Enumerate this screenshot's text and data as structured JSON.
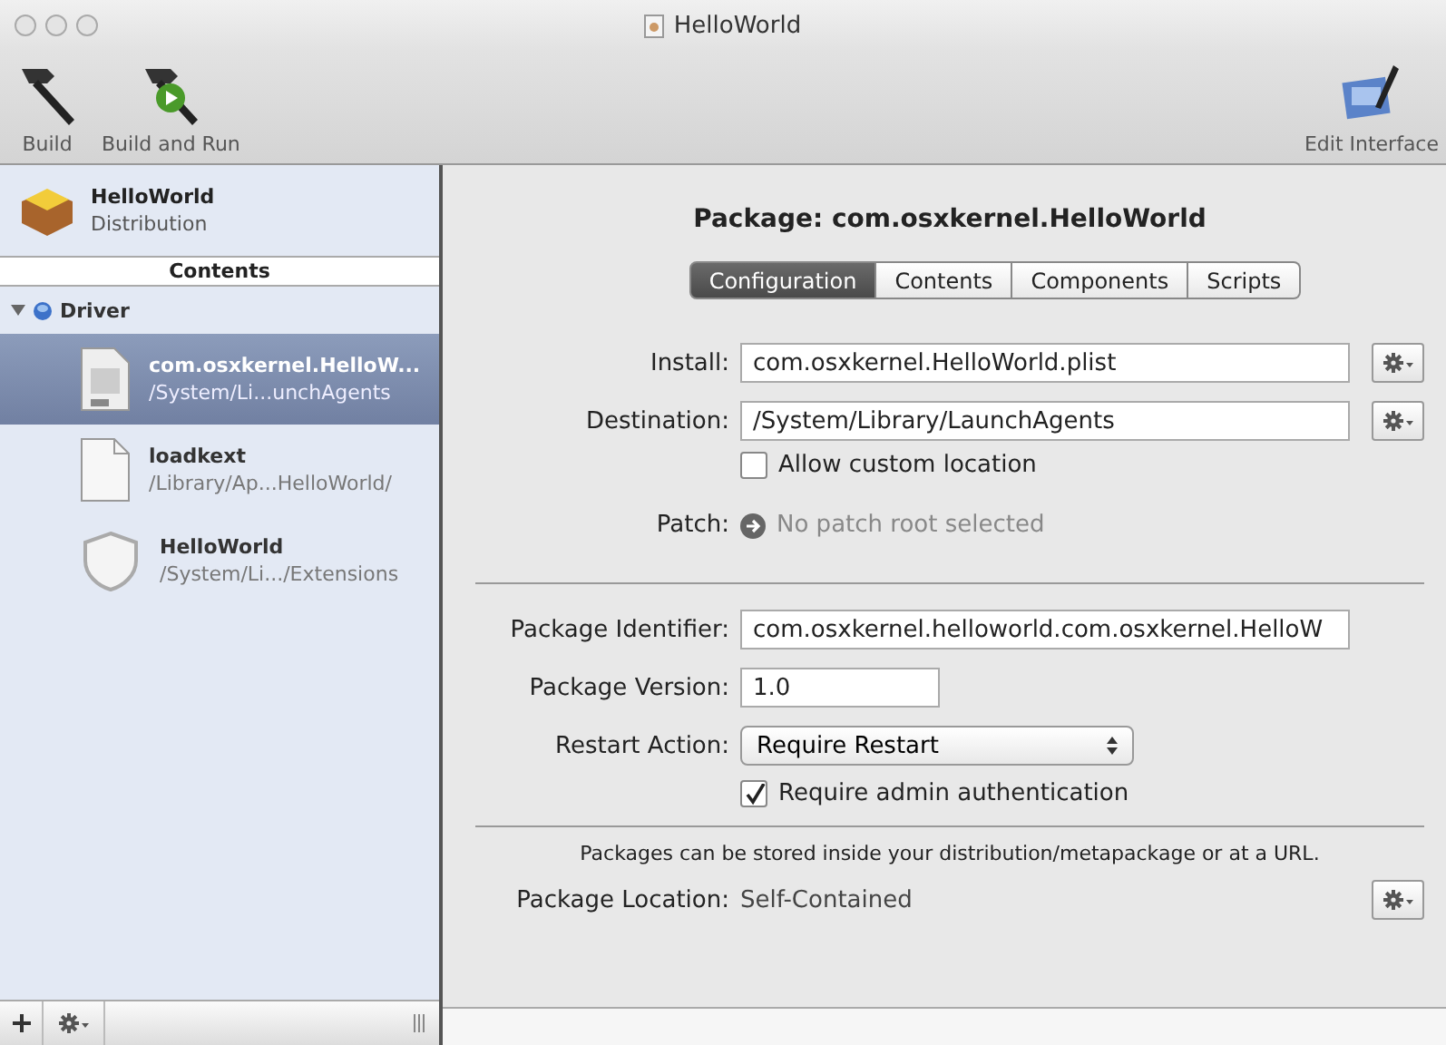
{
  "window": {
    "title": "HelloWorld"
  },
  "toolbar": {
    "items": [
      {
        "label": "Build",
        "kind": "build"
      },
      {
        "label": "Build and Run",
        "kind": "build_run"
      },
      {
        "label": "Edit Interface",
        "kind": "edit_interface"
      }
    ]
  },
  "sidebar": {
    "header": {
      "title": "HelloWorld",
      "subtitle": "Distribution"
    },
    "section_label": "Contents",
    "tree": [
      {
        "label": "Driver",
        "expanded": true,
        "children": [
          {
            "name": "com.osxkernel.HelloW...",
            "path": "/System/Li...unchAgents",
            "kind": "plist",
            "selected": true
          },
          {
            "name": "loadkext",
            "path": "/Library/Ap...HelloWorld/",
            "kind": "file",
            "selected": false
          },
          {
            "name": "HelloWorld",
            "path": "/System/Li.../Extensions",
            "kind": "kext",
            "selected": false
          }
        ]
      }
    ]
  },
  "main": {
    "title": "Package: com.osxkernel.HelloWorld",
    "tabs": [
      {
        "label": "Configuration",
        "selected": true
      },
      {
        "label": "Contents",
        "selected": false
      },
      {
        "label": "Components",
        "selected": false
      },
      {
        "label": "Scripts",
        "selected": false
      }
    ],
    "install": {
      "label": "Install:",
      "value": "com.osxkernel.HelloWorld.plist"
    },
    "destination": {
      "label": "Destination:",
      "value": "/System/Library/LaunchAgents"
    },
    "allow_custom": {
      "label": "Allow custom location",
      "checked": false
    },
    "patch": {
      "label": "Patch:",
      "value": "No patch root selected"
    },
    "identifier": {
      "label": "Package Identifier:",
      "value": "com.osxkernel.helloworld.com.osxkernel.HelloW"
    },
    "version": {
      "label": "Package Version:",
      "value": "1.0"
    },
    "restart": {
      "label": "Restart Action:",
      "value": "Require Restart"
    },
    "require_admin": {
      "label": "Require admin authentication",
      "checked": true
    },
    "note": "Packages can be stored inside your distribution/metapackage or at a URL.",
    "location": {
      "label": "Package Location:",
      "value": "Self-Contained"
    }
  }
}
